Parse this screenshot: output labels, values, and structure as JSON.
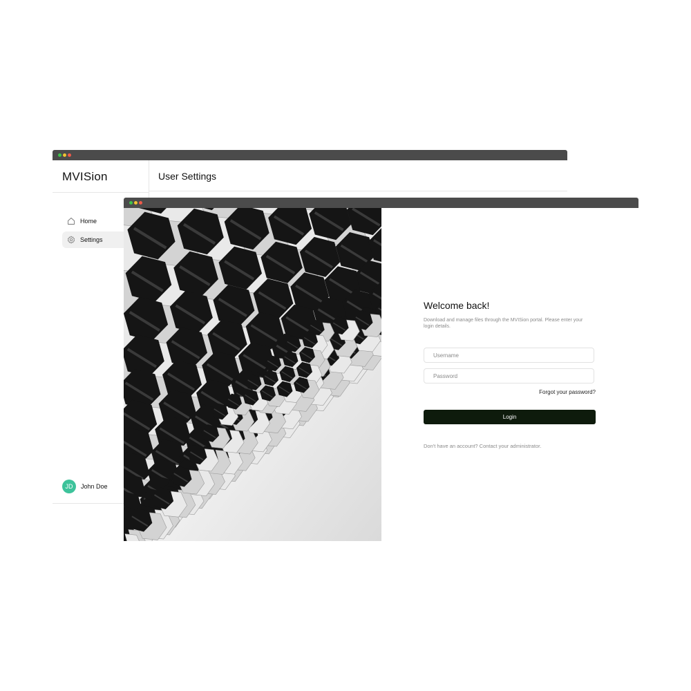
{
  "back_window": {
    "app_name": "MVISion",
    "page_title": "User Settings",
    "nav": [
      {
        "label": "Home",
        "icon": "home-icon",
        "active": false
      },
      {
        "label": "Settings",
        "icon": "gear-icon",
        "active": true
      }
    ],
    "user": {
      "initials": "JD",
      "name": "John Doe",
      "avatar_color": "#3dc39b"
    }
  },
  "front_window": {
    "photo": {
      "icon": "hexagon-pattern-photo"
    },
    "login": {
      "heading": "Welcome back!",
      "description": "Download and manage files through the MVISion portal. Please enter your login details.",
      "username_placeholder": "Username",
      "password_placeholder": "Password",
      "forgot_label": "Forgot your password?",
      "button_label": "Login",
      "signup_note": "Don't have an account? Contact your administrator."
    }
  },
  "colors": {
    "titlebar": "#4b4b4b",
    "login_button": "#0e1b0c",
    "traffic_green": "#3ec24a",
    "traffic_yellow": "#f1c232",
    "traffic_red": "#f05a4a"
  }
}
